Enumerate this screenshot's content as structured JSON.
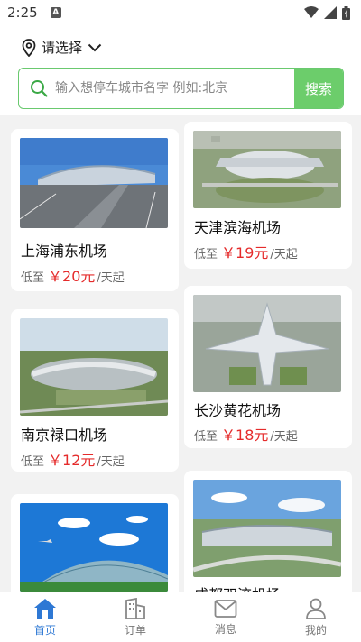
{
  "status": {
    "time": "2:25",
    "notif_glyph": "A"
  },
  "location": {
    "label": "请选择"
  },
  "search": {
    "placeholder": "输入想停车城市名字 例如:北京",
    "button": "搜索"
  },
  "cards": [
    {
      "name": "上海浦东机场",
      "prefix": "低至",
      "price": "￥20元",
      "suffix": "/天起"
    },
    {
      "name": "天津滨海机场",
      "prefix": "低至",
      "price": "￥19元",
      "suffix": "/天起"
    },
    {
      "name": "南京禄口机场",
      "prefix": "低至",
      "price": "￥12元",
      "suffix": "/天起"
    },
    {
      "name": "长沙黄花机场",
      "prefix": "低至",
      "price": "￥18元",
      "suffix": "/天起"
    },
    {
      "name": "",
      "prefix": "",
      "price": "",
      "suffix": ""
    },
    {
      "name": "成都双流机场",
      "prefix": "",
      "price": "",
      "suffix": ""
    }
  ],
  "tabs": [
    {
      "label": "首页",
      "icon": "home-icon",
      "active": true
    },
    {
      "label": "订单",
      "icon": "building-icon",
      "active": false
    },
    {
      "label": "消息",
      "icon": "envelope-icon",
      "active": false
    },
    {
      "label": "我的",
      "icon": "user-icon",
      "active": false
    }
  ],
  "colors": {
    "accent": "#6ccd6b",
    "price": "#e52b2b",
    "tab_active": "#2e78d4"
  }
}
